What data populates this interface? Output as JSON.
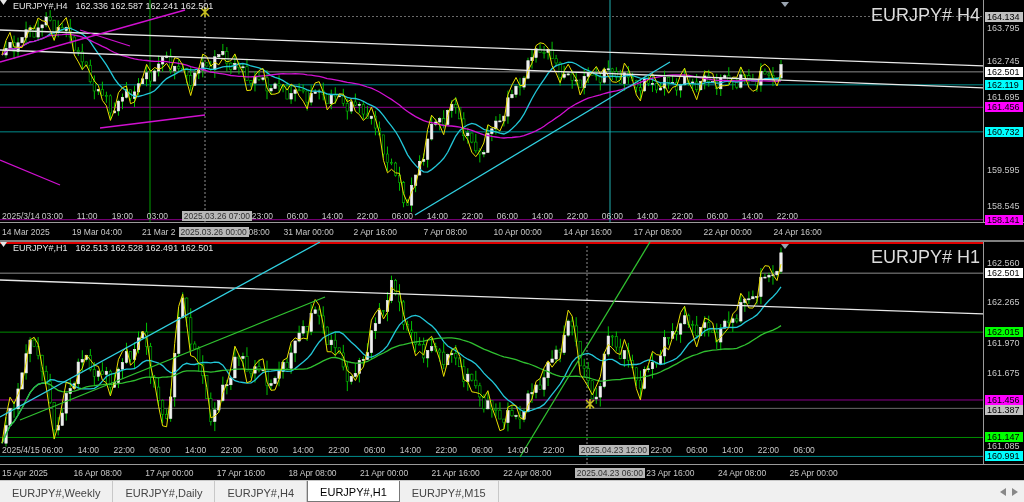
{
  "panels": [
    {
      "header": {
        "symbol": "EURJPY#,H4",
        "ohlc": "162.336 162.587 162.241 162.501"
      },
      "title": "EURJPY# H4",
      "price_ticks": [
        "163.795",
        "162.745",
        "161.695",
        "159.595",
        "158.545"
      ],
      "price_tags": [
        {
          "text": "164.134",
          "color": "#c0c0c0"
        },
        {
          "text": "162.501",
          "color": "#ffffff"
        },
        {
          "text": "162.119",
          "color": "#00ffff"
        },
        {
          "text": "161.456",
          "color": "#ff00ff"
        },
        {
          "text": "160.732",
          "color": "#00ffff"
        },
        {
          "text": "158.141",
          "color": "#ff00ff"
        }
      ],
      "hour_axis": [
        {
          "text": "2025/3/14",
          "kind": "start"
        },
        {
          "text": "03:00",
          "kind": "tick"
        },
        {
          "text": "11:00",
          "kind": "tick"
        },
        {
          "text": "19:00",
          "kind": "tick"
        },
        {
          "text": "03:00",
          "kind": "tick"
        },
        {
          "text": "2025.03.26 07:00",
          "kind": "cursor"
        },
        {
          "text": "23:00",
          "kind": "tick"
        },
        {
          "text": "06:00",
          "kind": "tick"
        },
        {
          "text": "14:00",
          "kind": "tick"
        },
        {
          "text": "22:00",
          "kind": "tick"
        },
        {
          "text": "06:00",
          "kind": "tick"
        },
        {
          "text": "14:00",
          "kind": "tick"
        },
        {
          "text": "22:00",
          "kind": "tick"
        },
        {
          "text": "06:00",
          "kind": "tick"
        },
        {
          "text": "14:00",
          "kind": "tick"
        },
        {
          "text": "22:00",
          "kind": "tick"
        },
        {
          "text": "06:00",
          "kind": "tick"
        },
        {
          "text": "14:00",
          "kind": "tick"
        },
        {
          "text": "22:00",
          "kind": "tick"
        },
        {
          "text": "06:00",
          "kind": "tick"
        },
        {
          "text": "14:00",
          "kind": "tick"
        },
        {
          "text": "22:00",
          "kind": "tick"
        }
      ],
      "date_axis": [
        {
          "text": "14 Mar 2025",
          "kind": "tick"
        },
        {
          "text": "19 Mar 04:00",
          "kind": "tick"
        },
        {
          "text": "21 Mar 2",
          "kind": "cut"
        },
        {
          "text": "2025.03.26 00:00",
          "kind": "cursor"
        },
        {
          "text": "08:00",
          "kind": "tail"
        },
        {
          "text": "31 Mar 00:00",
          "kind": "tick"
        },
        {
          "text": "2 Apr 16:00",
          "kind": "tick"
        },
        {
          "text": "7 Apr 08:00",
          "kind": "tick"
        },
        {
          "text": "10 Apr 00:00",
          "kind": "tick"
        },
        {
          "text": "14 Apr 16:00",
          "kind": "tick"
        },
        {
          "text": "17 Apr 08:00",
          "kind": "tick"
        },
        {
          "text": "22 Apr 00:00",
          "kind": "tick"
        },
        {
          "text": "24 Apr 16:00",
          "kind": "tick"
        }
      ]
    },
    {
      "header": {
        "symbol": "EURJPY#,H1",
        "ohlc": "162.513 162.528 162.491 162.501"
      },
      "title": "EURJPY# H1",
      "price_ticks": [
        "162.560",
        "162.265",
        "161.970",
        "161.675",
        "161.085"
      ],
      "price_tags": [
        {
          "text": "162.501",
          "color": "#ffffff"
        },
        {
          "text": "162.015",
          "color": "#00ff00"
        },
        {
          "text": "161.456",
          "color": "#ff00ff"
        },
        {
          "text": "161.387",
          "color": "#c0c0c0"
        },
        {
          "text": "161.147",
          "color": "#00ff00"
        },
        {
          "text": "160.991",
          "color": "#00ffff"
        }
      ],
      "hour_axis": [
        {
          "text": "2025/4/15",
          "kind": "start"
        },
        {
          "text": "06:00",
          "kind": "tick"
        },
        {
          "text": "14:00",
          "kind": "tick"
        },
        {
          "text": "22:00",
          "kind": "tick"
        },
        {
          "text": "06:00",
          "kind": "tick"
        },
        {
          "text": "14:00",
          "kind": "tick"
        },
        {
          "text": "22:00",
          "kind": "tick"
        },
        {
          "text": "06:00",
          "kind": "tick"
        },
        {
          "text": "14:00",
          "kind": "tick"
        },
        {
          "text": "22:00",
          "kind": "tick"
        },
        {
          "text": "06:00",
          "kind": "tick"
        },
        {
          "text": "14:00",
          "kind": "tick"
        },
        {
          "text": "22:00",
          "kind": "tick"
        },
        {
          "text": "06:00",
          "kind": "tick"
        },
        {
          "text": "14:00",
          "kind": "tick"
        },
        {
          "text": "22:00",
          "kind": "tick"
        },
        {
          "text": "2025.04.23 12:00",
          "kind": "cursor"
        },
        {
          "text": "22:00",
          "kind": "tick"
        },
        {
          "text": "06:00",
          "kind": "tick"
        },
        {
          "text": "14:00",
          "kind": "tick"
        },
        {
          "text": "22:00",
          "kind": "tick"
        },
        {
          "text": "06:00",
          "kind": "tick"
        }
      ],
      "date_axis": [
        {
          "text": "15 Apr 2025",
          "kind": "tick"
        },
        {
          "text": "16 Apr 08:00",
          "kind": "tick"
        },
        {
          "text": "17 Apr 00:00",
          "kind": "tick"
        },
        {
          "text": "17 Apr 16:00",
          "kind": "tick"
        },
        {
          "text": "18 Apr 08:00",
          "kind": "tick"
        },
        {
          "text": "21 Apr 00:00",
          "kind": "tick"
        },
        {
          "text": "21 Apr 16:00",
          "kind": "tick"
        },
        {
          "text": "22 Apr 08:00",
          "kind": "tick"
        },
        {
          "text": "2025.04.23 06:00",
          "kind": "cursor"
        },
        {
          "text": "23 Apr 16:00",
          "kind": "tick"
        },
        {
          "text": "24 Apr 08:00",
          "kind": "tick"
        },
        {
          "text": "25 Apr 00:00",
          "kind": "tick"
        }
      ]
    }
  ],
  "tabs": [
    {
      "label": "EURJPY#,Weekly",
      "selected": false
    },
    {
      "label": "EURJPY#,Daily",
      "selected": false
    },
    {
      "label": "EURJPY#,H4",
      "selected": false
    },
    {
      "label": "EURJPY#,H1",
      "selected": true
    },
    {
      "label": "EURJPY#,M15",
      "selected": false
    }
  ]
}
